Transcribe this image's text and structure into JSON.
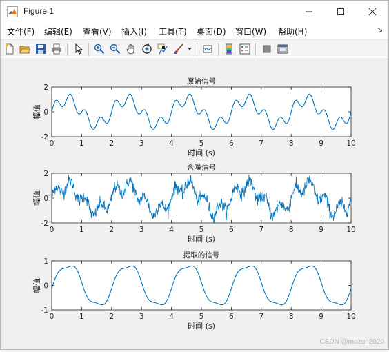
{
  "window": {
    "title": "Figure 1",
    "controls": {
      "minimize": "minimize",
      "maximize": "maximize",
      "close": "close"
    }
  },
  "menu": {
    "items": [
      "文件(F)",
      "编辑(E)",
      "查看(V)",
      "插入(I)",
      "工具(T)",
      "桌面(D)",
      "窗口(W)",
      "帮助(H)"
    ]
  },
  "toolbar": {
    "icons": [
      "new-figure-icon",
      "open-icon",
      "save-icon",
      "print-icon",
      "pointer-icon",
      "zoom-in-icon",
      "zoom-out-icon",
      "pan-icon",
      "rotate-3d-icon",
      "data-cursor-icon",
      "brush-icon",
      "link-plot-icon",
      "insert-colorbar-icon",
      "insert-legend-icon",
      "hide-plot-tools-icon",
      "show-plot-tools-icon"
    ]
  },
  "plot_color": "#0072bd",
  "chart_data": [
    {
      "type": "line",
      "title": "原始信号",
      "xlabel": "时间 (s)",
      "ylabel": "幅值",
      "xlim": [
        0,
        10
      ],
      "ylim": [
        -2,
        2
      ],
      "xticks": [
        "0",
        "1",
        "2",
        "3",
        "4",
        "5",
        "6",
        "7",
        "8",
        "9",
        "10"
      ],
      "yticks": [
        "2",
        "0",
        "-2"
      ],
      "signal": "sin(2*pi*0.5*t) + 0.5*sin(2*pi*2*t)",
      "series": [
        {
          "y_range_observed": [
            -1.4,
            1.45
          ]
        }
      ]
    },
    {
      "type": "line",
      "title": "含噪信号",
      "xlabel": "时间 (s)",
      "ylabel": "幅值",
      "xlim": [
        0,
        10
      ],
      "ylim": [
        -2,
        2
      ],
      "xticks": [
        "0",
        "1",
        "2",
        "3",
        "4",
        "5",
        "6",
        "7",
        "8",
        "9",
        "10"
      ],
      "yticks": [
        "2",
        "0",
        "-2"
      ],
      "signal": "sin(2*pi*0.5*t) + 0.5*sin(2*pi*2*t) + noise",
      "series": [
        {
          "y_range_observed": [
            -1.8,
            1.8
          ]
        }
      ]
    },
    {
      "type": "line",
      "title": "提取的信号",
      "xlabel": "时间 (s)",
      "ylabel": "幅值",
      "xlim": [
        0,
        10
      ],
      "ylim": [
        -1,
        1
      ],
      "xticks": [
        "0",
        "1",
        "2",
        "3",
        "4",
        "5",
        "6",
        "7",
        "8",
        "9",
        "10"
      ],
      "yticks": [
        "1",
        "0",
        "-1"
      ],
      "signal": "0.9*sin(2*pi*0.5*t) low-pass extracted",
      "series": [
        {
          "y_range_observed": [
            -0.75,
            0.9
          ]
        }
      ]
    }
  ],
  "watermark": "CSDN @mozun2020"
}
